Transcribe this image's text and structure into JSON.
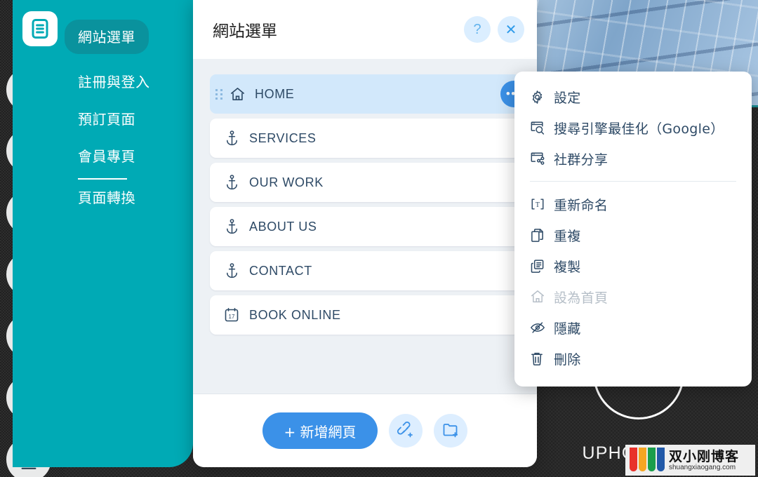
{
  "site_background": {
    "wordmark": "UPHOLSTERY",
    "logo_icon": "sofa-circle-logo"
  },
  "watermark": {
    "title": "双小刚博客",
    "url": "shuangxiaogang.com"
  },
  "rail": {
    "items": [
      {
        "name": "site-menu-toggle",
        "icon": "document-list-icon"
      },
      {
        "name": "pages-icon",
        "icon": "square-outline-icon"
      },
      {
        "name": "add-element",
        "icon": "plus-circle-icon"
      },
      {
        "name": "theme-design",
        "icon": "letter-a-droplet-icon"
      },
      {
        "name": "apps-market",
        "icon": "apps-grid-plus-icon"
      },
      {
        "name": "media-manager",
        "icon": "media-images-icon"
      },
      {
        "name": "blog-editor",
        "icon": "fountain-pen-icon"
      },
      {
        "name": "bookings",
        "icon": "calendar-17-icon"
      }
    ]
  },
  "site_menu": {
    "pill_label": "網站選單",
    "links": [
      "註冊與登入",
      "預訂頁面",
      "會員專頁"
    ],
    "after_divider": "頁面轉換"
  },
  "dialog": {
    "title": "網站選單",
    "help_label": "?",
    "close_label": "✕",
    "pages": [
      {
        "label": "HOME",
        "icon": "home-icon",
        "selected": true
      },
      {
        "label": "SERVICES",
        "icon": "anchor-icon",
        "selected": false
      },
      {
        "label": "OUR WORK",
        "icon": "anchor-icon",
        "selected": false
      },
      {
        "label": "ABOUT US",
        "icon": "anchor-icon",
        "selected": false
      },
      {
        "label": "CONTACT",
        "icon": "anchor-icon",
        "selected": false
      },
      {
        "label": "BOOK ONLINE",
        "icon": "calendar-icon",
        "selected": false
      }
    ],
    "more_button_label": "•••",
    "footer": {
      "add_page_label": "+ 新增網頁",
      "link_button_icon": "link-plus-icon",
      "folder_button_icon": "folder-plus-icon"
    }
  },
  "context_menu": {
    "items": [
      {
        "label": "設定",
        "icon": "gear-icon",
        "disabled": false
      },
      {
        "label": "搜尋引擎最佳化（Google）",
        "icon": "seo-search-icon",
        "disabled": false
      },
      {
        "label": "社群分享",
        "icon": "social-share-icon",
        "disabled": false
      },
      {
        "label": "重新命名",
        "icon": "rename-text-icon",
        "disabled": false
      },
      {
        "label": "重複",
        "icon": "duplicate-icon",
        "disabled": false
      },
      {
        "label": "複製",
        "icon": "copy-icon",
        "disabled": false
      },
      {
        "label": "設為首頁",
        "icon": "home-outline-icon",
        "disabled": true
      },
      {
        "label": "隱藏",
        "icon": "eye-off-icon",
        "disabled": false
      },
      {
        "label": "刪除",
        "icon": "trash-icon",
        "disabled": false
      }
    ],
    "separator_after_index": 2
  },
  "colors": {
    "teal": "#00aab5",
    "teal_pill": "#0a929d",
    "accent_blue": "#3b91e8",
    "selected_row": "#d2e8fb",
    "panel_bg": "#edf1f5",
    "ink": "#2e4a66"
  }
}
